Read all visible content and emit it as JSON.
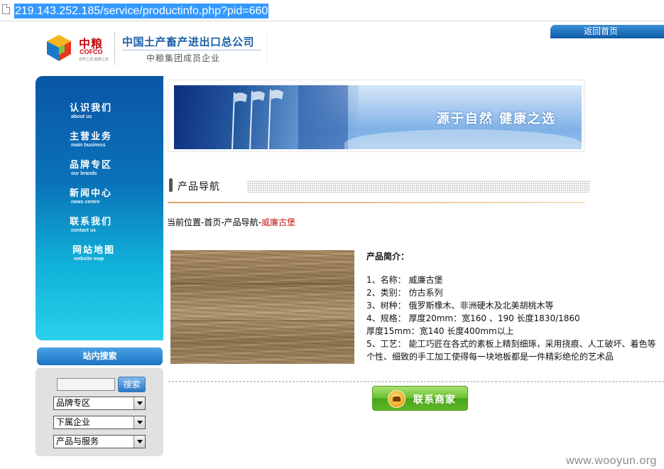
{
  "address_bar": {
    "url": "219.143.252.185/service/productinfo.php?pid=660"
  },
  "header": {
    "logo_cn": "中粮",
    "logo_en": "COFCO",
    "logo_tagline": "自然之源 健康之选",
    "company_name": "中国土产畜产进出口总公司",
    "company_sub": "中粮集团成员企业",
    "back_home": "返回首页"
  },
  "nav": {
    "items": [
      {
        "cn": "认识我们",
        "en": "about us"
      },
      {
        "cn": "主营业务",
        "en": "main business"
      },
      {
        "cn": "品牌专区",
        "en": "our brands"
      },
      {
        "cn": "新闻中心",
        "en": "news centre"
      },
      {
        "cn": "联系我们",
        "en": "contact us"
      },
      {
        "cn": "网站地图",
        "en": "website map"
      }
    ]
  },
  "search": {
    "title": "站内搜索",
    "keyword_value": "",
    "button": "搜索",
    "selects": [
      "品牌专区",
      "下属企业",
      "产品与服务"
    ]
  },
  "banner": {
    "slogan": "源于自然  健康之选"
  },
  "section": {
    "title": "产品导航"
  },
  "breadcrumb": {
    "prefix": "当前位置-首页-产品导航-",
    "current": "威廉古堡"
  },
  "product": {
    "intro_title": "产品简介：",
    "lines": [
      "1、名称：  威廉古堡",
      "2、类别：  仿古系列",
      "3、树种：  俄罗斯橡木、非洲硬木及北美胡桃木等",
      "4、规格：  厚度20mm：宽160 、190 长度1830/1860",
      "厚度15mm：宽140 长度400mm以上",
      "5、工艺：  能工巧匠在各式的素板上精刻细琢，采用挠痕、人工破坏、着色等个性、细致的手工加工使得每一块地板都是一件精彩绝伦的艺术品"
    ]
  },
  "contact_button": "联系商家",
  "watermark": "www.wooyun.org",
  "colors": {
    "brand_red": "#c00d12",
    "brand_blue": "#1d5fa6",
    "nav_top": "#0a56a6",
    "nav_bottom": "#2ad0ea",
    "breadcrumb_current": "#c4161c",
    "contact_green": "#6cc232"
  }
}
